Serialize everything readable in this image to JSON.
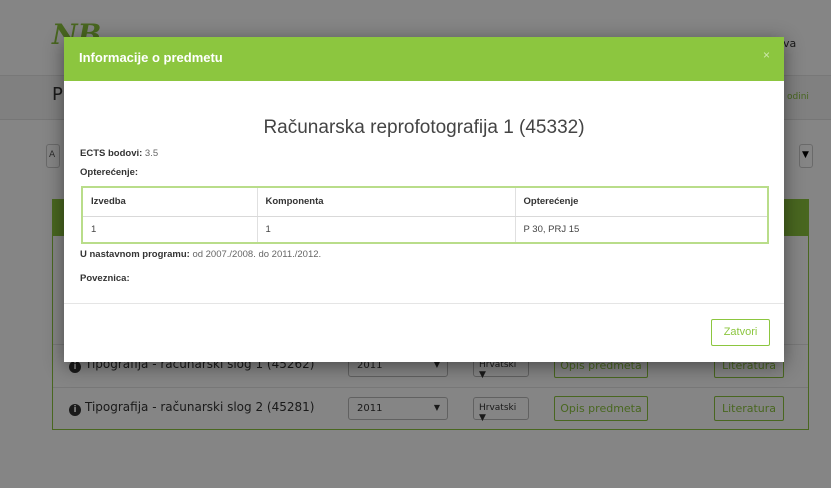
{
  "background": {
    "logo": "NB",
    "user_text": "va",
    "page_title": "P",
    "page_link": "odini",
    "search_text": "A",
    "rows": [
      {
        "course": "Tipografija - računarski slog 1 (45262)",
        "year": "2011",
        "language": "Hrvatski",
        "opis_label": "Opis predmeta",
        "literatura_label": "Literatura"
      },
      {
        "course": "Tipografija - računarski slog 2 (45281)",
        "year": "2011",
        "language": "Hrvatski",
        "opis_label": "Opis predmeta",
        "literatura_label": "Literatura"
      }
    ]
  },
  "modal": {
    "title": "Informacije o predmetu",
    "close_icon": "×",
    "course_name": "Računarska reprofotografija 1 (45332)",
    "ects_label": "ECTS bodovi:",
    "ects_value": "3.5",
    "opterecenje_label": "Opterećenje:",
    "table": {
      "headers": [
        "Izvedba",
        "Komponenta",
        "Opterećenje"
      ],
      "rows": [
        [
          "1",
          "1",
          "P 30, PRJ 15"
        ]
      ]
    },
    "program_label": "U nastavnom programu:",
    "program_value": "od 2007./2008. do 2011./2012.",
    "poveznica_label": "Poveznica:",
    "close_button": "Zatvori"
  },
  "colors": {
    "accent": "#8cc63f",
    "overlay": "rgba(0,0,0,0.48)"
  },
  "icons": {
    "info": "info-circle-icon",
    "close": "close-icon",
    "dropdown": "caret-down-icon"
  }
}
